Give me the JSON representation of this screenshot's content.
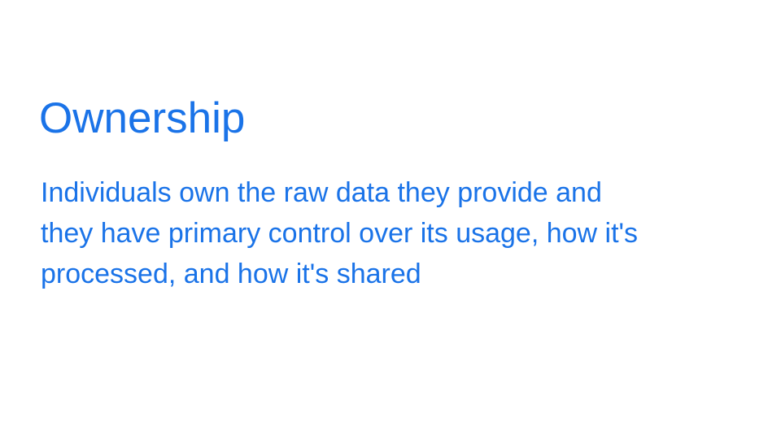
{
  "slide": {
    "title": "Ownership",
    "body_lines": [
      "Individuals own the raw data they provide and",
      "they have primary control over its usage, how it's",
      "processed, and how it's shared"
    ],
    "accent_color": "#1a73e8"
  }
}
